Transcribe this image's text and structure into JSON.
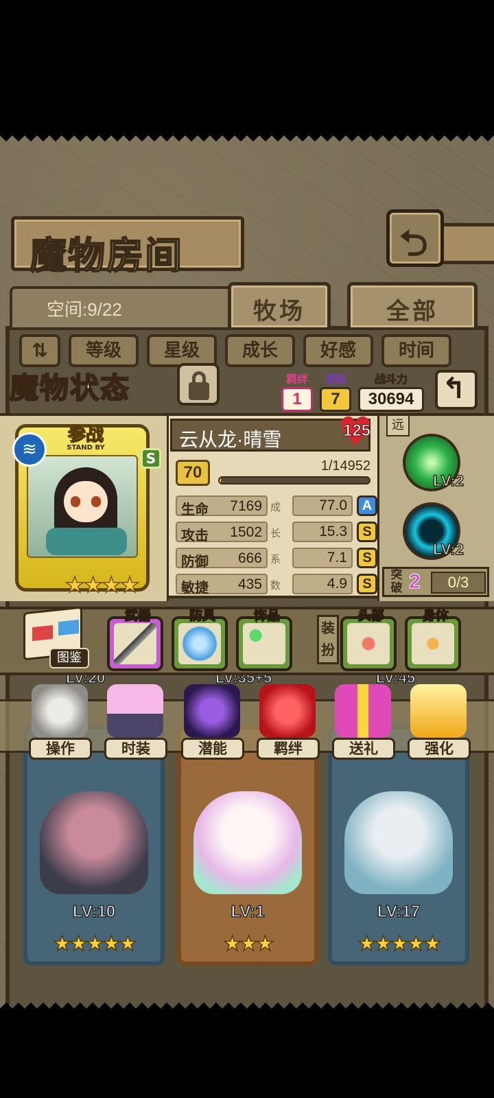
{
  "header": {
    "title": "魔物房间",
    "back_icon": "return-arrow-icon"
  },
  "tabs": {
    "space_label": "空间:9/22",
    "items": [
      "牧场",
      "全部"
    ]
  },
  "filters": [
    "等级",
    "星级",
    "成长",
    "好感",
    "时间"
  ],
  "status": {
    "title": "魔物状态",
    "bond": {
      "label": "羁绊",
      "value": "1"
    },
    "potential": {
      "label": "潜能",
      "value": "7"
    },
    "power": {
      "label": "战斗力",
      "value": "30694"
    },
    "monster_name": "云从龙·晴雪",
    "affection": "125",
    "level": "70",
    "exp_text": "1/14952",
    "exp_fraction": 0.0001,
    "standby_cn": "参战",
    "standby_en": "STAND BY",
    "card_grade": "S",
    "card_stars": "★★★★",
    "growth_chars": [
      "成",
      "长",
      "系",
      "数"
    ],
    "stats": [
      {
        "label": "生命",
        "value": "7169",
        "growth": "77.0",
        "grade": "A"
      },
      {
        "label": "攻击",
        "value": "1502",
        "growth": "15.3",
        "grade": "S"
      },
      {
        "label": "防御",
        "value": "666",
        "growth": "7.1",
        "grade": "S"
      },
      {
        "label": "敏捷",
        "value": "435",
        "growth": "4.9",
        "grade": "S"
      }
    ],
    "range": "远",
    "skills": [
      {
        "lv": "LV:2"
      },
      {
        "lv": "LV:2"
      }
    ],
    "breakthrough": {
      "label": "突破",
      "count": "2",
      "progress": "0/3"
    }
  },
  "equipment": {
    "book_label": "图鉴",
    "weapon": "武器",
    "armor": "防具",
    "accessory": "饰品",
    "dress_label": "装扮",
    "head": "头部",
    "body": "身体"
  },
  "actions": [
    "操作",
    "时装",
    "潜能",
    "羁绊",
    "送礼",
    "强化"
  ],
  "roster": {
    "top_levels": [
      "LV:20",
      "LV:35+5",
      "LV:45"
    ],
    "cards": [
      {
        "lv": "LV:10",
        "stars": "★★★★★"
      },
      {
        "lv": "LV:1",
        "stars": "★★★"
      },
      {
        "lv": "LV:17",
        "stars": "★★★★★"
      }
    ]
  }
}
